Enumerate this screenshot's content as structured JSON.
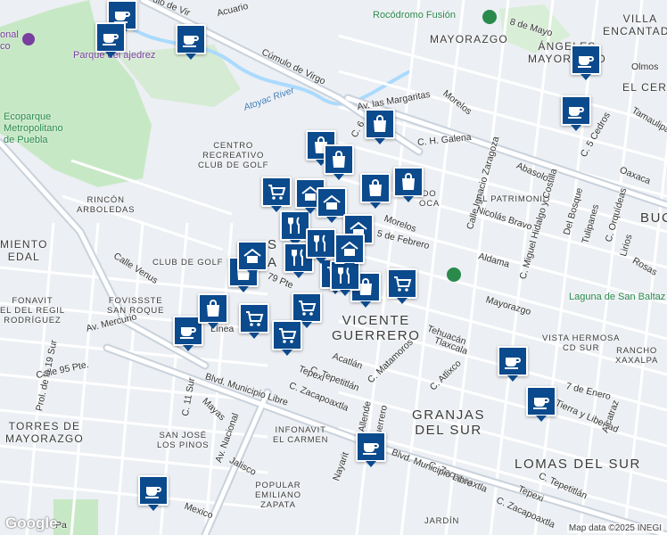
{
  "map": {
    "attribution": "Map data ©2025 INEGI",
    "logo": "Google",
    "colors": {
      "land": "#eceff3",
      "park": "#c7e8c5",
      "road": "#ffffff",
      "major_road": "#c9d2dc",
      "water": "#aadaff",
      "marker": "#0b4a8c"
    }
  },
  "pois": {
    "rocodromo": "Rocódromo Fusión",
    "parque_ajedrez": "Parque del ajedrez",
    "ecoparque": "Ecoparque\nMetropolitano\nde Puebla",
    "nacional": "onal\nco",
    "atoyac": "Atoyac River"
  },
  "neighborhoods": {
    "villa_encantada": "VILLA\nENCANTADA",
    "mayorazgo": "MAYORAZGO",
    "angeles_mayorazgo": "ÁNGELES\nMAYORAZGO",
    "el_cerrit": "EL CERRIT",
    "centro_recreativo": "CENTRO\nRECREATIVO\nCLUB DE GOLF",
    "rincon_arboledas": "RINCÓN\nARBOLEDAS",
    "miento_edal": "MIENTO\nEDAL",
    "club_de_golf": "CLUB DE GOLF",
    "el_patrimonio": "EL PATRIMONIO",
    "buc": "BUC",
    "vicente_guerrero": "VICENTE\nGUERRERO",
    "infonavit_regil": "FONAVIT\nEL DEL REGIL\nRODRÍGUEZ",
    "fovissste": "FOVISSSTE\nSAN ROQUE",
    "vista_hermosa": "VISTA HERMOSA\nCD SUR",
    "rancho_xaxalpa": "RANCHO\nXAXALPA",
    "granjas_del_sur": "GRANJAS\nDEL SUR",
    "lomas_del_sur": "LOMAS DEL SUR",
    "torres_mayorazgo": "TORRES DE\nMAYORAZGO",
    "san_jose_pinos": "SAN JOSÉ\nLOS PINOS",
    "infonavit_carmen": "INFONAVIT\nEL CARMEN",
    "popular_zapata": "POPULAR\nEMILIANO\nZAPATA",
    "laguna": "Laguna de San Baltaz",
    "jardin": "JARDÍN",
    "do_oca": "DO\nOCA"
  },
  "streets": {
    "cumulo_virgo": "Cúmulo de Virgo",
    "acuario": "Acuario",
    "ulo_de_vir": "ulo de Vir",
    "ocho_mayo": "8 de Mayo",
    "olmos": "Olmos",
    "av_margaritas": "Av. las Margaritas",
    "morelos_1": "Morelos",
    "c6": "C. 6",
    "c_h_galena": "C. H. Galena",
    "c_cedros": "C. 5 Cedros",
    "tamaulipas": "Tamaulipa",
    "oaxaca": "Oaxaca",
    "abasolo": "Abasolo",
    "zaragoza": "Calle Ignacio Zaragoza",
    "nicolas_bravo": "Nicolás Bravo",
    "hidalgo": "C. Miguel Hidalgo y Costilla",
    "del_bosque": "Del Bosque",
    "tulipanes": "Tulipanes",
    "orquideas": "C. Orquídeas",
    "lirios": "Lirios",
    "rosas": "Rosas",
    "morelos_2": "Morelos",
    "cinco_feb": "5 de Febrero",
    "aldama": "Aldama",
    "mayorazgo_st": "Mayorazgo",
    "calle_venus": "Calle Venus",
    "setenta_nueve": "79 Pte",
    "av_mercurio": "Av. Mercurio",
    "calle_95": "Calle 95 Pte.",
    "prol_19": "Prol. de la 19 Sur",
    "tehuacan": "Tehuacán",
    "tlaxcala": "Tlaxcala",
    "acatlan": "Acatlán",
    "c_matamoros": "C. Matamoros",
    "c_atlixco": "C. Atlixco",
    "c_tepetitlan": "C. Tepetitlán",
    "tepexi": "Tepexi",
    "c_zacapoaxtla": "C. Zacapoaxtla",
    "blvd_municipio": "Blvd. Municipio Libre",
    "c_11_sur": "C. 11 Sur",
    "mayas": "Mayas",
    "av_nacional": "Av. Nacional",
    "jalisco": "Jalisco",
    "mexico": "Mexico",
    "nayarit": "Nayarit",
    "allende": "Allende",
    "guerrero": "Guerrero",
    "c_zacapoaxtla_2": "C. Zacapoaxtla",
    "blvd_municipio_2": "Blvd. Municipio Libre",
    "c_tepetitlan_2": "C. Tepetitlán",
    "tepexi_2": "Tepexi",
    "c_zacapoaxtla_3": "C. Zacapoaxtla",
    "siete_enero": "7 de Enero",
    "tierra_libertad": "Tierra y Libertad",
    "alcatraz": "Alcatraz",
    "pa": "Pa",
    "linea": "Línea",
    "s_prefix": "S",
    "a_prefix": "A"
  },
  "markers": [
    {
      "type": "coffee"
    },
    {
      "type": "coffee"
    },
    {
      "type": "coffee"
    },
    {
      "type": "coffee"
    },
    {
      "type": "coffee"
    },
    {
      "type": "coffee"
    },
    {
      "type": "coffee"
    },
    {
      "type": "coffee"
    },
    {
      "type": "coffee"
    },
    {
      "type": "coffee"
    },
    {
      "type": "bag"
    },
    {
      "type": "bag"
    },
    {
      "type": "bag"
    },
    {
      "type": "bag"
    },
    {
      "type": "bag"
    },
    {
      "type": "bag"
    },
    {
      "type": "bag"
    },
    {
      "type": "bag"
    },
    {
      "type": "cart"
    },
    {
      "type": "cart"
    },
    {
      "type": "cart"
    },
    {
      "type": "cart"
    },
    {
      "type": "cart"
    },
    {
      "type": "cart"
    },
    {
      "type": "restaurant"
    },
    {
      "type": "restaurant"
    },
    {
      "type": "restaurant"
    },
    {
      "type": "restaurant"
    },
    {
      "type": "hotel"
    },
    {
      "type": "hotel"
    },
    {
      "type": "hotel"
    },
    {
      "type": "hotel"
    },
    {
      "type": "hotel"
    }
  ]
}
